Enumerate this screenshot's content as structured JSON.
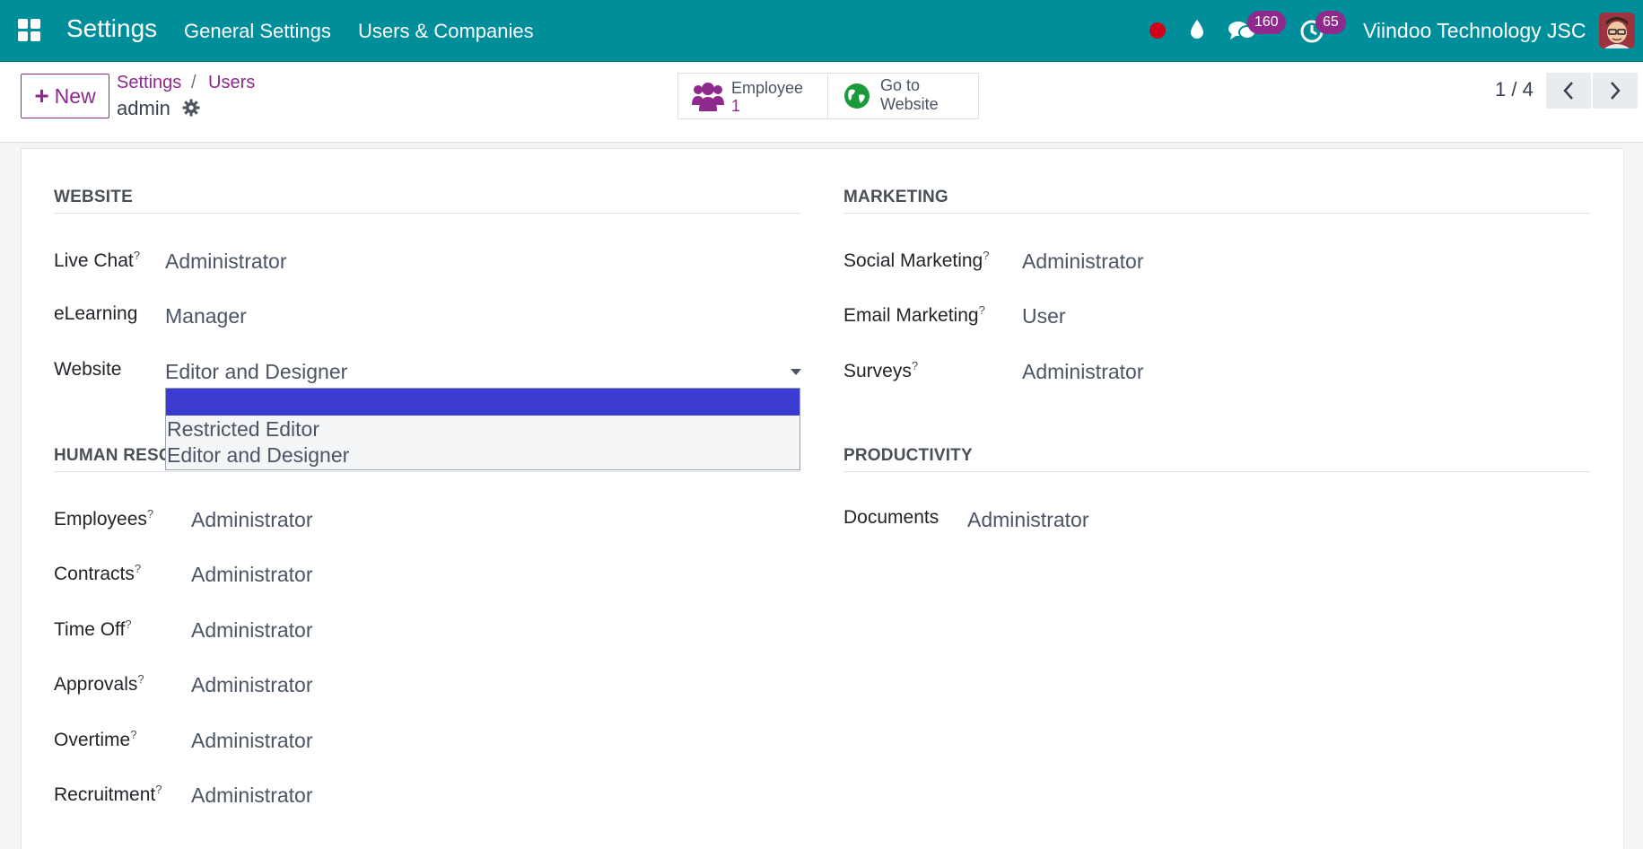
{
  "navbar": {
    "brand": "Settings",
    "menu": [
      "General Settings",
      "Users & Companies"
    ],
    "chat_badge": "160",
    "activity_badge": "65",
    "company": "Viindoo Technology JSC",
    "colors": {
      "bar": "#008f9a",
      "badge": "#8e2a8c",
      "record_dot": "#d0021b"
    }
  },
  "control_panel": {
    "new_label": "New",
    "breadcrumb": [
      "Settings",
      "Users"
    ],
    "breadcrumb_sep": "/",
    "record_name": "admin",
    "employee_button": {
      "label": "Employee",
      "count": "1"
    },
    "website_button": {
      "line1": "Go to",
      "line2": "Website"
    },
    "pager": "1 / 4"
  },
  "sections": {
    "website": {
      "title": "WEBSITE",
      "fields": [
        {
          "label": "Live Chat",
          "help": "?",
          "value": "Administrator"
        },
        {
          "label": "eLearning",
          "help": "",
          "value": "Manager"
        },
        {
          "label": "Website",
          "help": "",
          "value": "Editor and Designer"
        }
      ]
    },
    "marketing": {
      "title": "MARKETING",
      "fields": [
        {
          "label": "Social Marketing",
          "help": "?",
          "value": "Administrator"
        },
        {
          "label": "Email Marketing",
          "help": "?",
          "value": "User"
        },
        {
          "label": "Surveys",
          "help": "?",
          "value": "Administrator"
        }
      ]
    },
    "human_resources": {
      "title": "HUMAN RESOURCES",
      "fields": [
        {
          "label": "Employees",
          "help": "?",
          "value": "Administrator"
        },
        {
          "label": "Contracts",
          "help": "?",
          "value": "Administrator"
        },
        {
          "label": "Time Off",
          "help": "?",
          "value": "Administrator"
        },
        {
          "label": "Approvals",
          "help": "?",
          "value": "Administrator"
        },
        {
          "label": "Overtime",
          "help": "?",
          "value": "Administrator"
        },
        {
          "label": "Recruitment",
          "help": "?",
          "value": "Administrator"
        }
      ]
    },
    "productivity": {
      "title": "PRODUCTIVITY",
      "fields": [
        {
          "label": "Documents",
          "help": "",
          "value": "Administrator"
        }
      ]
    }
  },
  "website_dropdown": {
    "options": [
      "",
      "Restricted Editor",
      "Editor and Designer"
    ],
    "highlighted_index": 0
  },
  "icons": [
    "apps-grid-icon",
    "record-dot-icon",
    "droplet-icon",
    "chat-icon",
    "activity-clock-icon",
    "avatar",
    "gear-icon",
    "users-icon",
    "globe-icon",
    "chevron-left-icon",
    "chevron-right-icon",
    "caret-down-icon"
  ]
}
